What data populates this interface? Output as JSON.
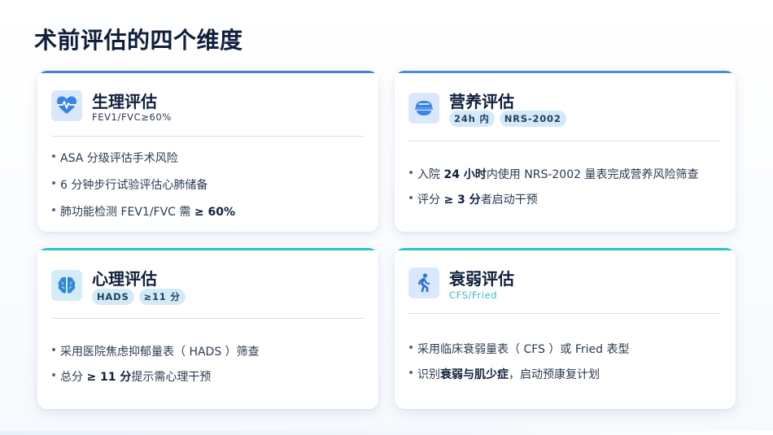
{
  "page": {
    "title": "术前评估的四个维度"
  },
  "colors": {
    "blue_accent": "#4a7fd1",
    "teal_accent": "#33c2c4",
    "icon_bg": "#d9e8fb",
    "pill_bg": "#d3ebf8"
  },
  "cards": {
    "physio": {
      "title": "生理评估",
      "subtitle": "FEV1/FVC≥60%",
      "icon": "heartbeat-icon",
      "items": [
        {
          "t1": "ASA  分级评估手术风险",
          "b": "",
          "t2": ""
        },
        {
          "t1": "6  分钟步行试验评估心肺储备",
          "b": "",
          "t2": ""
        },
        {
          "t1": "肺功能检测  FEV1/FVC  需 ",
          "b": "≥ 60%",
          "t2": ""
        }
      ]
    },
    "nutrition": {
      "title": "营养评估",
      "icon": "food-bowl-icon",
      "pills": [
        "24h 内",
        "NRS-2002"
      ],
      "items": [
        {
          "t1": "入院  ",
          "b": "24  小时",
          "t2": "内使用  NRS-2002  量表完成营养风险筛查"
        },
        {
          "t1": "评分 ",
          "b": "≥ 3  分",
          "t2": "者启动干预"
        }
      ]
    },
    "psych": {
      "title": "心理评估",
      "icon": "brain-icon",
      "pills": [
        "HADS",
        "≥11 分"
      ],
      "items": [
        {
          "t1": "采用医院焦虑抑郁量表（  HADS  ）筛查",
          "b": "",
          "t2": ""
        },
        {
          "t1": "总分 ",
          "b": "≥ 11  分",
          "t2": "提示需心理干预"
        }
      ]
    },
    "frailty": {
      "title": "衰弱评估",
      "subtitle": "CFS/Fried",
      "icon": "walking-person-icon",
      "items": [
        {
          "t1": "采用临床衰弱量表（  CFS  ）或  Fried  表型",
          "b": "",
          "t2": ""
        },
        {
          "t1": "识别",
          "b": "衰弱与肌少症",
          "t2": "，启动预康复计划"
        }
      ]
    }
  }
}
